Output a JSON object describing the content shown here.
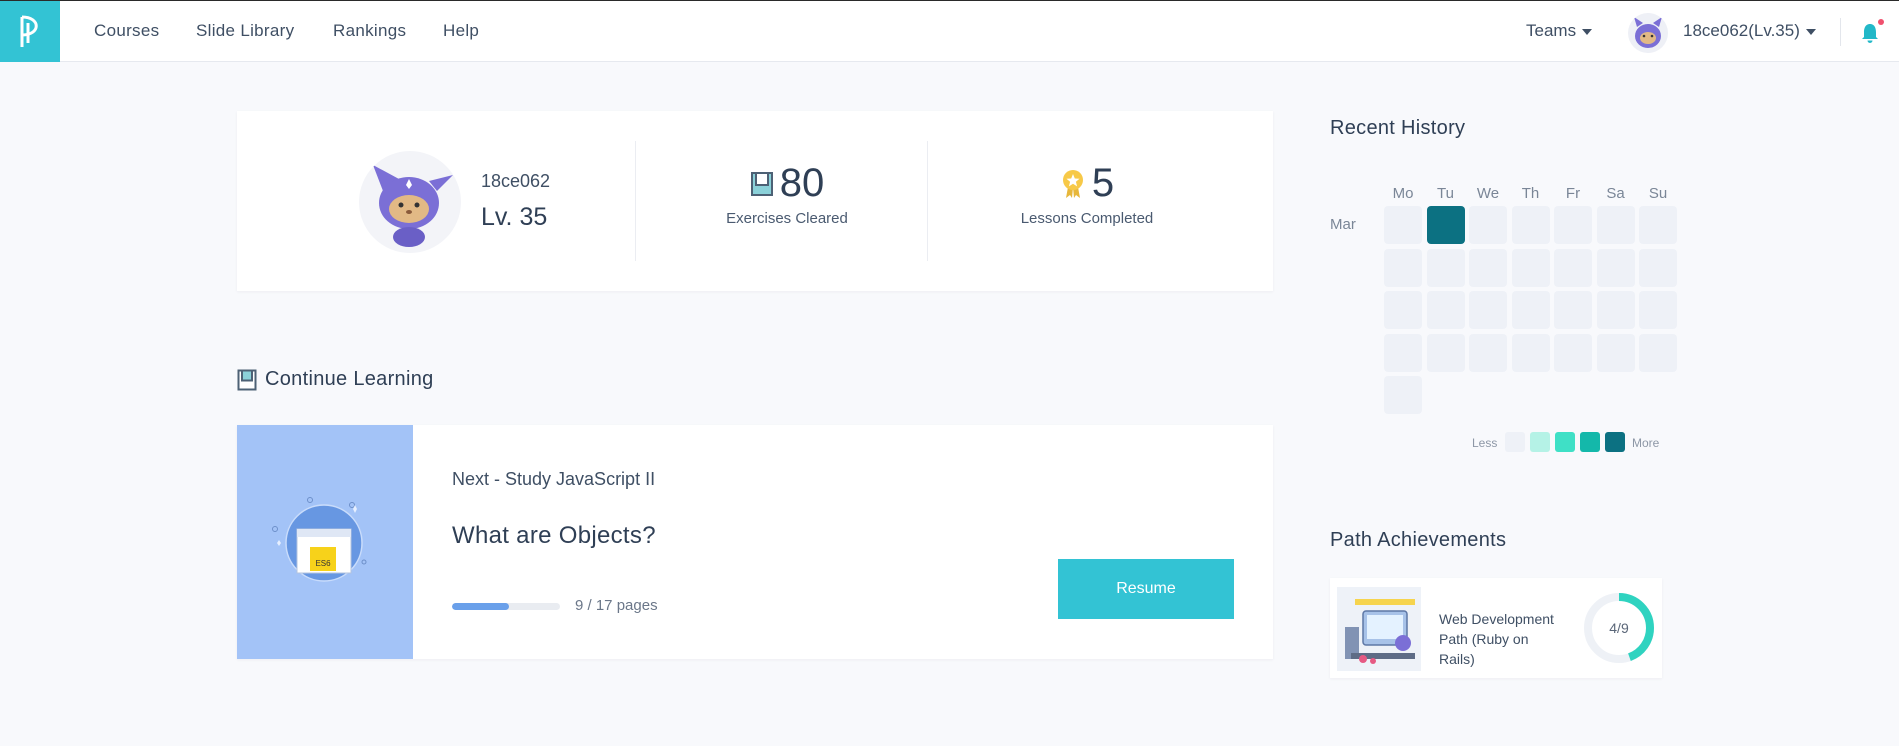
{
  "nav": {
    "links": [
      "Courses",
      "Slide Library",
      "Rankings",
      "Help"
    ],
    "teams": "Teams",
    "user": "18ce062(Lv.35)"
  },
  "profile": {
    "username": "18ce062",
    "level": "Lv. 35",
    "exercises_cleared": "80",
    "exercises_label": "Exercises Cleared",
    "lessons_completed": "5",
    "lessons_label": "Lessons Completed"
  },
  "continue_learning": {
    "title": "Continue Learning",
    "next": "Next - Study JavaScript II",
    "lesson_title": "What are Objects?",
    "progress_text": "9 / 17 pages",
    "progress_fraction": 0.529,
    "resume": "Resume",
    "thumb_badge": "ES6"
  },
  "history": {
    "title": "Recent History",
    "days": [
      "Mo",
      "Tu",
      "We",
      "Th",
      "Fr",
      "Sa",
      "Su"
    ],
    "month": "Mar",
    "active_cells": [
      1
    ],
    "total_cells": 29,
    "legend_less": "Less",
    "legend_more": "More",
    "legend_colors": [
      "#eef1f7",
      "#b5f2e6",
      "#3fe0c6",
      "#14b8aa",
      "#0c7182"
    ]
  },
  "path": {
    "title": "Path Achievements",
    "name": "Web Development Path (Ruby on Rails)",
    "progress_text": "4/9",
    "done": 4,
    "total": 9,
    "color": "#2fd3c0"
  },
  "colors": {
    "accent": "#33c3d4",
    "active_day": "#0c7182",
    "thumb_bg": "#a3c3f7"
  }
}
